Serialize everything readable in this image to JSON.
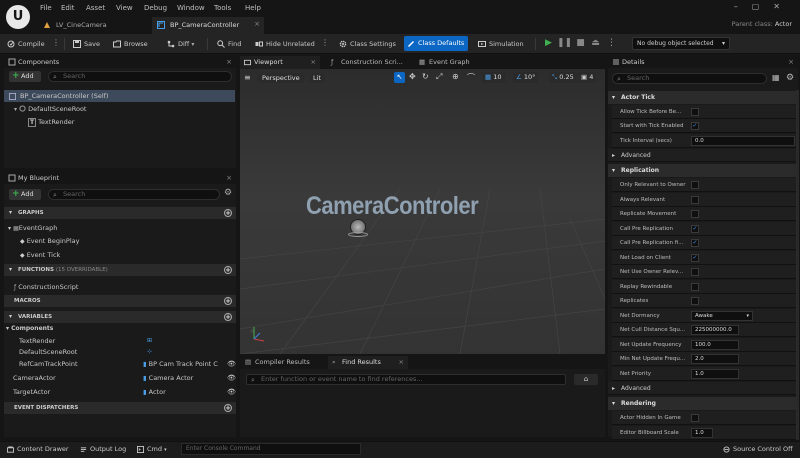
{
  "menu": [
    "File",
    "Edit",
    "Asset",
    "View",
    "Debug",
    "Window",
    "Tools",
    "Help"
  ],
  "tabs": [
    {
      "label": "LV_CineCamera"
    },
    {
      "label": "BP_CameraController"
    }
  ],
  "parent_class": {
    "label": "Parent class:",
    "value": "Actor"
  },
  "toolbar": {
    "compile": "Compile",
    "save": "Save",
    "browse": "Browse",
    "diff": "Diff",
    "find": "Find",
    "hide_unrelated": "Hide Unrelated",
    "class_settings": "Class Settings",
    "class_defaults": "Class Defaults",
    "simulation": "Simulation",
    "debug_object": "No debug object selected"
  },
  "components": {
    "title": "Components",
    "add": "Add",
    "search_placeholder": "Search",
    "items": [
      "BP_CameraController (Self)",
      "DefaultSceneRoot",
      "TextRender"
    ]
  },
  "my_blueprint": {
    "title": "My Blueprint",
    "add": "Add",
    "search_placeholder": "Search",
    "graphs_header": "GRAPHS",
    "graphs": [
      "EventGraph",
      "Event BeginPlay",
      "Event Tick"
    ],
    "functions_header": "FUNCTIONS",
    "functions_note": "(15 OVERRIDABLE)",
    "functions": [
      "ConstructionScript"
    ],
    "macros_header": "MACROS",
    "variables_header": "VARIABLES",
    "components_header": "Components",
    "variables": [
      {
        "name": "TextRender",
        "type": ""
      },
      {
        "name": "DefaultSceneRoot",
        "type": ""
      },
      {
        "name": "RefCamTrackPoint",
        "type": "BP Cam Track Point C"
      },
      {
        "name": "CameraActor",
        "type": "Camera Actor"
      },
      {
        "name": "TargetActor",
        "type": "Actor"
      }
    ],
    "dispatchers_header": "EVENT DISPATCHERS"
  },
  "center_tabs": [
    "Viewport",
    "Construction Scri...",
    "Event Graph"
  ],
  "viewport": {
    "perspective": "Perspective",
    "lit": "Lit",
    "grid": "10",
    "angle": "10°",
    "scale": "0.25",
    "cam_speed": "4",
    "scene_text": "CameraControler"
  },
  "bottom_tabs": [
    "Compiler Results",
    "Find Results"
  ],
  "find": {
    "placeholder": "Enter function or event name to find references..."
  },
  "details": {
    "title": "Details",
    "search_placeholder": "Search",
    "actor_tick": "Actor Tick",
    "tick_rows": [
      {
        "label": "Allow Tick Before Be...",
        "checked": false
      },
      {
        "label": "Start with Tick Enabled",
        "checked": true
      }
    ],
    "tick_interval_label": "Tick Interval (secs)",
    "tick_interval": "0.0",
    "advanced": "Advanced",
    "replication": "Replication",
    "rep_rows": [
      {
        "label": "Only Relevant to Owner",
        "checked": false
      },
      {
        "label": "Always Relevant",
        "checked": false
      },
      {
        "label": "Replicate Movement",
        "checked": false
      },
      {
        "label": "Call Pre Replication",
        "checked": true
      },
      {
        "label": "Call Pre Replication fi...",
        "checked": true
      },
      {
        "label": "Net Load on Client",
        "checked": true
      },
      {
        "label": "Net Use Owner Relev...",
        "checked": false
      },
      {
        "label": "Replay Rewindable",
        "checked": false
      },
      {
        "label": "Replicates",
        "checked": false
      }
    ],
    "net_dormancy_label": "Net Dormancy",
    "net_dormancy": "Awake",
    "net_cull_label": "Net Cull Distance Squ...",
    "net_cull": "225000000.0",
    "net_update_label": "Net Update Frequency",
    "net_update": "100.0",
    "min_net_label": "Min Net Update Frequ...",
    "min_net": "2.0",
    "net_priority_label": "Net Priority",
    "net_priority": "1.0",
    "advanced2": "Advanced",
    "rendering": "Rendering",
    "hidden_label": "Actor Hidden In Game",
    "billboard_label": "Editor Billboard Scale",
    "billboard": "1.0"
  },
  "status": {
    "content_drawer": "Content Drawer",
    "output_log": "Output Log",
    "cmd": "Cmd",
    "console_placeholder": "Enter Console Command",
    "source_control": "Source Control Off"
  }
}
